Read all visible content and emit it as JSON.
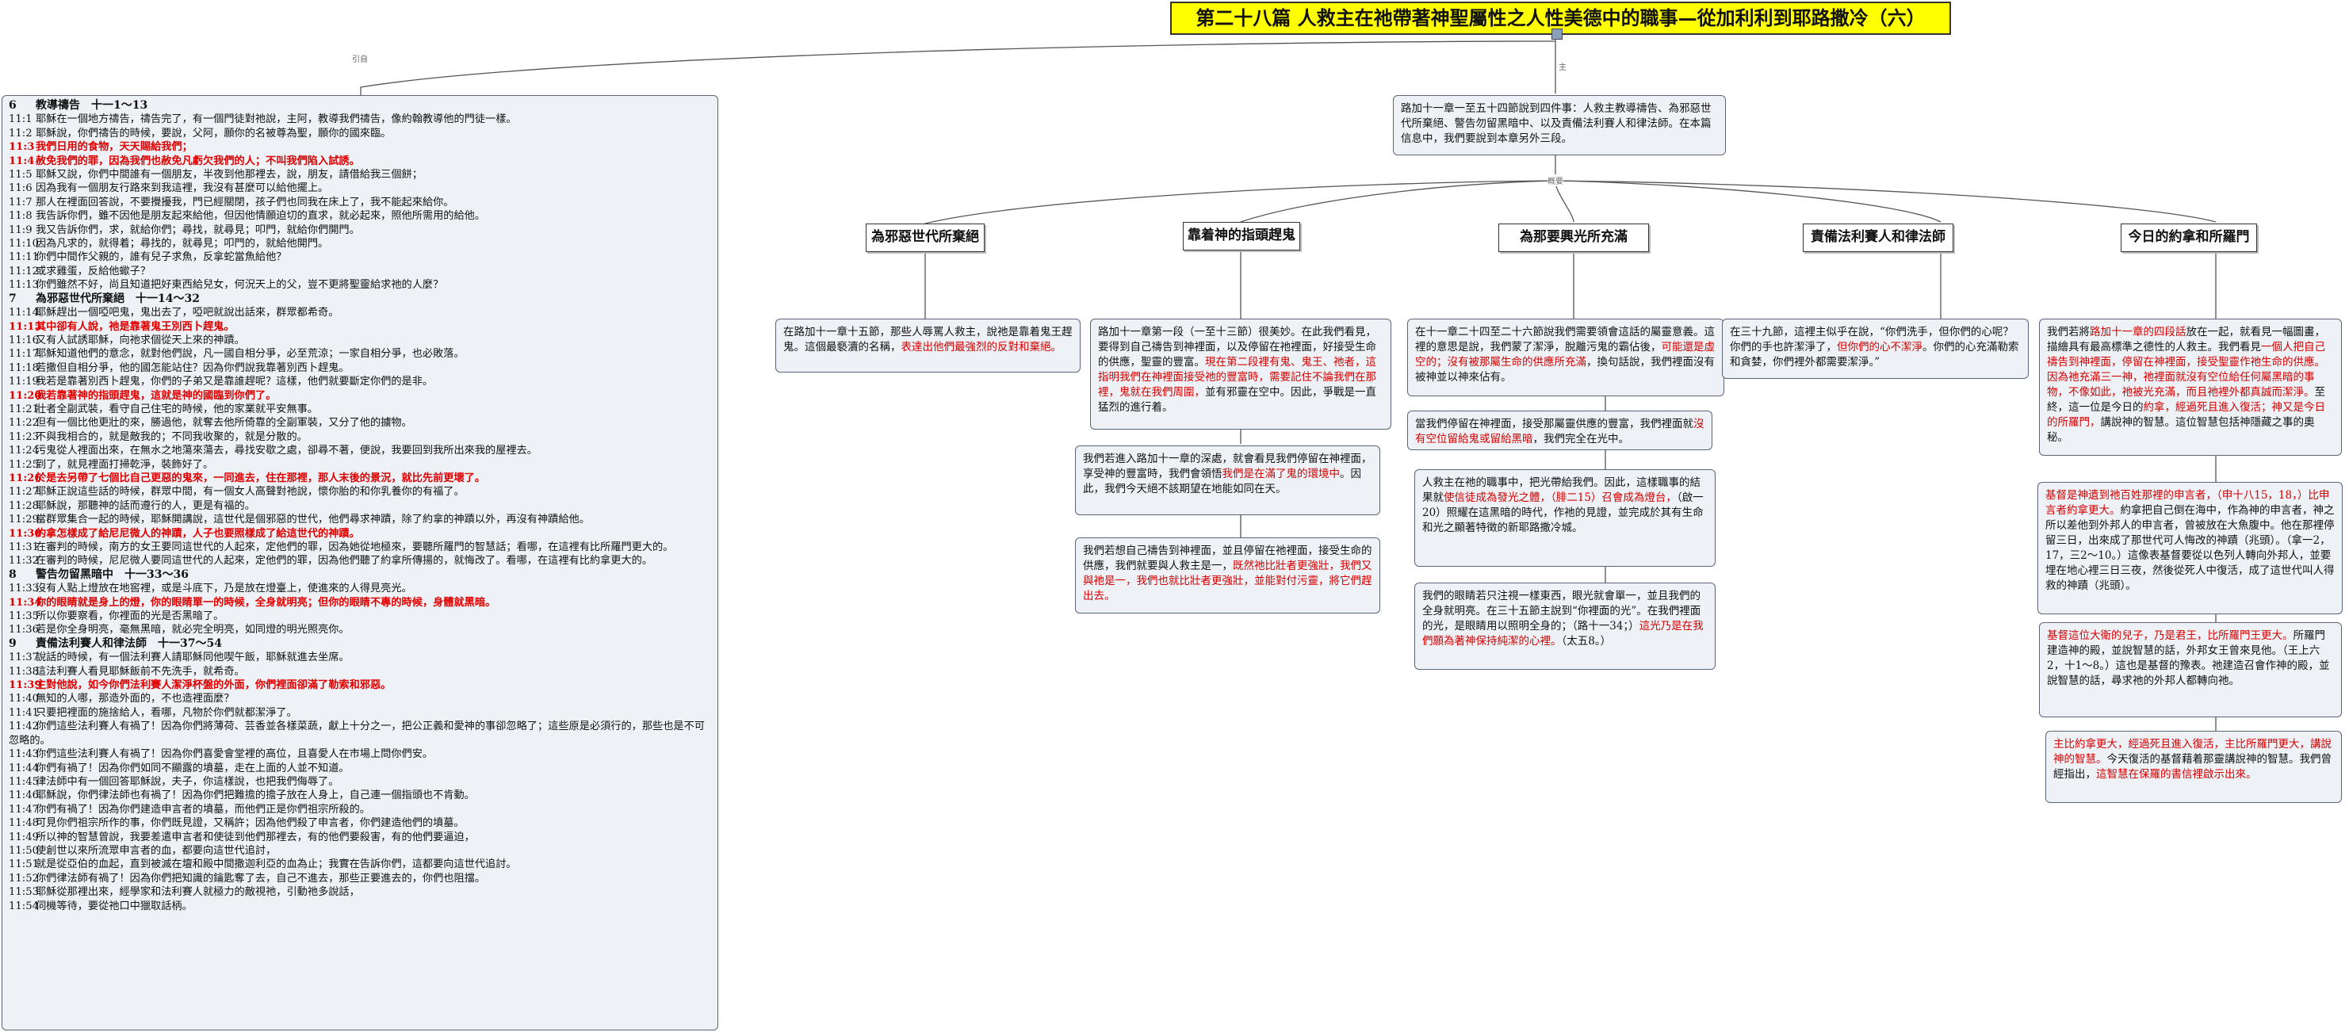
{
  "title": "第二十八篇 人救主在祂帶著神聖屬性之人性美德中的職事—從加利利到耶路撒冷（六）",
  "link_labels": {
    "quote": "引自",
    "topic": "主",
    "outline": "概要"
  },
  "outline": "路加十一章一至五十四節說到四件事：人救主教導禱告、為邪惡世代所棄絕、警告勿留黑暗中、以及責備法利賽人和律法師。在本篇信息中，我們要說到本章另外三段。",
  "headings": [
    "為邪惡世代所棄絕",
    "靠着神的指頭趕鬼",
    "為那要興光所充滿",
    "責備法利賽人和律法師",
    "今日的約拿和所羅門"
  ],
  "notes": {
    "rejected": [
      {
        "t": "在路加十一章十五節，那些人辱罵人救主，說祂是靠着鬼王趕鬼。這個最褻瀆的名稱，",
        "r": false
      },
      {
        "t": "表達出他們最強烈的反對和棄絕。",
        "r": true
      }
    ],
    "finger_1": [
      {
        "t": "路加十一章第一段（一至十三節）很美妙。在此我們看見，要得到自己禱告到神裡面，以及停留在祂裡面，好接受生命的供應，聖靈的豐富。",
        "r": false
      },
      {
        "t": "現在第二段裡有鬼、鬼王、祂者，這指明我們在神裡面接受祂的豐富時，需要記住不論我們在那裡，鬼就在我們周圍，",
        "r": true
      },
      {
        "t": "並有邪靈在空中。因此，爭戰是一直猛烈的進行着。",
        "r": false
      }
    ],
    "finger_2": [
      {
        "t": "我們若進入路加十一章的深處，就會看見我們停留在神裡面，享受神的豐富時，我們會領悟",
        "r": false
      },
      {
        "t": "我們是在滿了鬼的環境中",
        "r": true
      },
      {
        "t": "。因此，我們今天絕不該期望在地能如同在天。",
        "r": false
      }
    ],
    "finger_3": [
      {
        "t": "我們若想自己禱告到神裡面，並且停留在祂裡面，接受生命的供應，我們就要與人救主是一，",
        "r": false
      },
      {
        "t": "既然祂比壯者更強壯，我們又與祂是一，我們也就比壯者更強壯，並能對付污靈，將它們趕出去。",
        "r": true
      }
    ],
    "filled_1": [
      {
        "t": "在十一章二十四至二十六節說我們需要領會這話的屬靈意義。這裡的意思是說，我們蒙了潔淨，脫離污鬼的霸佔後，",
        "r": false
      },
      {
        "t": "可能還是虛空的；沒有被那屬生命的供應所充滿",
        "r": true
      },
      {
        "t": "，換句話說，我們裡面沒有被神並以神來佔有。",
        "r": false
      }
    ],
    "filled_2": [
      {
        "t": "當我們停留在神裡面，接受那屬靈供應的豐富，我們裡面就",
        "r": false
      },
      {
        "t": "沒有空位留給鬼或留給黑暗",
        "r": true
      },
      {
        "t": "，我們完全在光中。",
        "r": false
      }
    ],
    "filled_3": [
      {
        "t": "人救主在祂的職事中，把光帶給我們。因此，這樣職事的結果就",
        "r": false
      },
      {
        "t": "使信徒成為發光之體，（腓二15）召會成為燈台，",
        "r": true
      },
      {
        "t": "（啟一20）照耀在這黑暗的時代，作祂的見證，並完成於其有生命和光之顯著特徵的新耶路撒冷城。",
        "r": false
      }
    ],
    "filled_4": [
      {
        "t": "我們的眼睛若只注視一樣東西，眼光就會單一，並且我們的全身就明亮。在三十五節主說到“你裡面的光”。在我們裡面的光，是眼睛用以照明全身的；（路十一34；）",
        "r": false
      },
      {
        "t": "這光乃是在我們願為著神保持純潔的心裡。",
        "r": true
      },
      {
        "t": "（太五8。）",
        "r": false
      }
    ],
    "pharisees": [
      {
        "t": "在三十九節，這裡主似乎在說，“你們洗手，但你們的心呢？你們的手也許潔淨了，",
        "r": false
      },
      {
        "t": "但你們的心不潔淨",
        "r": true
      },
      {
        "t": "。你們的心充滿勒索和貪婪，你們裡外都需要潔淨。”",
        "r": false
      }
    ],
    "jonah_1": [
      {
        "t": "我們若將",
        "r": false
      },
      {
        "t": "路加十一章的四段話",
        "r": true
      },
      {
        "t": "放在一起，就看見一幅圖畫，描繪具有最高標準之德性的人救主。我們看見",
        "r": false
      },
      {
        "t": "一個人把自己禱告到神裡面，停留在神裡面，接受聖靈作祂生命的供應。因為祂充滿三一神，祂裡面就沒有空位給任何屬黑暗的事物，不像如此，祂被光充滿，而且祂裡外都真誠而潔淨。",
        "r": true
      },
      {
        "t": "至終，這一位是今日的",
        "r": false
      },
      {
        "t": "約拿，經過死且進入復活；神又是今日的所羅門，",
        "r": true
      },
      {
        "t": "講說神的智慧。這位智慧包括神隱藏之事的奧秘。",
        "r": false
      }
    ],
    "jonah_2": [
      {
        "t": "基督是神遺到祂百姓那裡的申言者，（申十八15，18，）比申言者約拿更大。",
        "r": true
      },
      {
        "t": "約拿把自己倒在海中，作為神的申言者，神之所以差他到外邦人的申言者，曾被放在大魚腹中。他在那裡停留三日，出來成了那世代可人悔改的神蹟（兆頭）。（拿一2，17，三2～10。）這像表基督要從以色列人轉向外邦人，並要埋在地心裡三日三夜，然後從死人中復活，成了這世代叫人得救的神蹟（兆頭）。",
        "r": false
      }
    ],
    "jonah_3": [
      {
        "t": "基督這位大衛的兒子，乃是君王，比所羅門王更大。",
        "r": true
      },
      {
        "t": "所羅門建造神的殿，並說智慧的話，外邦女王曾來見他。（王上六2，十1～8。）這也是基督的豫表。祂建造召會作神的殿，並說智慧的話，尋求祂的外邦人都轉向祂。",
        "r": false
      }
    ],
    "jonah_4": [
      {
        "t": "主比約拿更大，經過死且進入復活，主比所羅門更大，講說神的智慧。",
        "r": true
      },
      {
        "t": "今天復活的基督藉着那靈講說神的智慧。我們曾經指出，",
        "r": false
      },
      {
        "t": "這智慧在保羅的書信裡啟示出來。",
        "r": true
      }
    ]
  },
  "verses": [
    {
      "n": "6",
      "t": "教導禱告　十一1～13",
      "sec": true
    },
    {
      "n": "11:1",
      "t": "耶穌在一個地方禱告，禱告完了，有一個門徒對祂說，主阿，教導我們禱告，像約翰教導他的門徒一樣。"
    },
    {
      "n": "11:2",
      "t": "耶穌說，你們禱告的時候，要說，父阿，願你的名被尊為聖，願你的國來臨。"
    },
    {
      "n": "11:3",
      "t": "我們日用的食物，天天賜給我們；",
      "hl": true
    },
    {
      "n": "11:4",
      "t": "赦免我們的罪，因為我們也赦免凡虧欠我們的人；不叫我們陷入試誘。",
      "hl": true
    },
    {
      "n": "11:5",
      "t": "耶穌又說，你們中間誰有一個朋友，半夜到他那裡去，說，朋友，請借給我三個餅；"
    },
    {
      "n": "11:6",
      "t": "因為我有一個朋友行路來到我這裡，我沒有甚麼可以給他擺上。"
    },
    {
      "n": "11:7",
      "t": "那人在裡面回答說，不要攪擾我，門已經關閉，孩子們也同我在床上了，我不能起來給你。"
    },
    {
      "n": "11:8",
      "t": "我告訴你們，雖不因他是朋友起來給他，但因他情願迫切的直求，就必起來，照他所需用的給他。"
    },
    {
      "n": "11:9",
      "t": "我又告訴你們，求，就給你們；尋找，就尋見；叩門，就給你們開門。"
    },
    {
      "n": "11:10",
      "t": "因為凡求的，就得着；尋找的，就尋見；叩門的，就給他開門。"
    },
    {
      "n": "11:11",
      "t": "你們中間作父親的，誰有兒子求魚，反拿蛇當魚給他？"
    },
    {
      "n": "11:12",
      "t": "或求雞蛋，反給他蠍子？"
    },
    {
      "n": "11:13",
      "t": "你們雖然不好，尚且知道把好東西給兒女，何況天上的父，豈不更將聖靈給求祂的人麼？"
    },
    {
      "n": "7",
      "t": "為邪惡世代所棄絕　十一14～32",
      "sec": true
    },
    {
      "n": "11:14",
      "t": "耶穌趕出一個啞吧鬼，鬼出去了，啞吧就說出話來，群眾都希奇。"
    },
    {
      "n": "11:15",
      "t": "其中卻有人說，祂是靠著鬼王別西卜趕鬼。",
      "hl": true
    },
    {
      "n": "11:16",
      "t": "又有人試誘耶穌，向祂求個從天上來的神蹟。"
    },
    {
      "n": "11:17",
      "t": "耶穌知道他們的意念，就對他們說，凡一國自相分爭，必至荒涼；一家自相分爭，也必敗落。"
    },
    {
      "n": "11:18",
      "t": "若撒但自相分爭，他的國怎能站住？因為你們說我靠著別西卜趕鬼。"
    },
    {
      "n": "11:19",
      "t": "我若是靠著別西卜趕鬼，你們的子弟又是靠誰趕呢？這樣，他們就要斷定你們的是非。"
    },
    {
      "n": "11:20",
      "t": "我若靠著神的指頭趕鬼，這就是神的國臨到你們了。",
      "hl": true
    },
    {
      "n": "11:21",
      "t": "壯者全副武裝，看守自己住宅的時候，他的家業就平安無事。"
    },
    {
      "n": "11:22",
      "t": "但有一個比他更壯的來，勝過他，就奪去他所倚靠的全副軍裝，又分了他的擄物。"
    },
    {
      "n": "11:23",
      "t": "不與我相合的，就是敵我的；不同我收聚的，就是分散的。"
    },
    {
      "n": "11:24",
      "t": "污鬼從人裡面出來，在無水之地蕩來蕩去，尋找安歇之處，卻尋不著，便說，我要回到我所出來我的屋裡去。"
    },
    {
      "n": "11:25",
      "t": "到了，就見裡面打掃乾淨，裝飾好了。"
    },
    {
      "n": "11:26",
      "t": "於是去另帶了七個比自己更惡的鬼來，一同進去，住在那裡，那人末後的景況，就比先前更壞了。",
      "hl": true
    },
    {
      "n": "11:27",
      "t": "耶穌正說這些話的時候，群眾中間，有一個女人高聲對祂說，懷你胎的和你乳養你的有福了。"
    },
    {
      "n": "11:28",
      "t": "耶穌說，那聽神的話而遵行的人，更是有福的。"
    },
    {
      "n": "11:29",
      "t": "當群眾集合一起的時候，耶穌開講說，這世代是個邪惡的世代，他們尋求神蹟，除了約拿的神蹟以外，再沒有神蹟給他。"
    },
    {
      "n": "11:30",
      "t": "約拿怎樣成了給尼尼微人的神蹟，人子也要照樣成了給這世代的神蹟。",
      "hl": true
    },
    {
      "n": "11:31",
      "t": "在審判的時候，南方的女王要同這世代的人起來，定他們的罪，因為她從地極來，要聽所羅門的智慧話；看哪，在這裡有比所羅門更大的。",
      "wrap": true
    },
    {
      "n": "11:32",
      "t": "在審判的時候，尼尼微人要同這世代的人起來，定他們的罪，因為他們聽了約拿所傳揚的，就悔改了。看哪，在這裡有比約拿更大的。",
      "wrap": true
    },
    {
      "n": "8",
      "t": "警告勿留黑暗中　十一33～36",
      "sec": true
    },
    {
      "n": "11:33",
      "t": "沒有人點上燈放在地窖裡，或是斗底下，乃是放在燈臺上，使進來的人得見亮光。"
    },
    {
      "n": "11:34",
      "t": "你的眼睛就是身上的燈，你的眼睛單一的時候，全身就明亮；但你的眼睛不專的時候，身體就黑暗。",
      "hl": true
    },
    {
      "n": "11:35",
      "t": "所以你要察看，你裡面的光是否黑暗了。"
    },
    {
      "n": "11:36",
      "t": "若是你全身明亮，毫無黑暗，就必完全明亮，如同燈的明光照亮你。"
    },
    {
      "n": "9",
      "t": "責備法利賽人和律法師　十一37～54",
      "sec": true
    },
    {
      "n": "11:37",
      "t": "說話的時候，有一個法利賽人請耶穌同他喫午飯，耶穌就進去坐席。"
    },
    {
      "n": "11:38",
      "t": "這法利賽人看見耶穌飯前不先洗手，就希奇。"
    },
    {
      "n": "11:39",
      "t": "主對他說，如今你們法利賽人潔淨杯盤的外面，你們裡面卻滿了勒索和邪惡。",
      "hl": true
    },
    {
      "n": "11:40",
      "t": "無知的人哪，那造外面的，不也造裡面麼？"
    },
    {
      "n": "11:41",
      "t": "只要把裡面的施捨給人，看哪，凡物於你們就都潔淨了。"
    },
    {
      "n": "11:42",
      "t": "你們這些法利賽人有禍了！因為你們將薄荷、芸香並各樣菜蔬，獻上十分之一，把公正義和愛神的事卻忽略了；這些原是必須行的，那些也是不可忽略的。",
      "wrap": true
    },
    {
      "n": "11:43",
      "t": "你們這些法利賽人有禍了！因為你們喜愛會堂裡的高位，且喜愛人在市場上問你們安。"
    },
    {
      "n": "11:44",
      "t": "你們有禍了！因為你們如同不顯露的墳墓，走在上面的人並不知道。"
    },
    {
      "n": "11:45",
      "t": "律法師中有一個回答耶穌說，夫子，你這樣說，也把我們侮辱了。"
    },
    {
      "n": "11:46",
      "t": "耶穌說，你們律法師也有禍了！因為你們把難擔的擔子放在人身上，自己連一個指頭也不肯動。"
    },
    {
      "n": "11:47",
      "t": "你們有禍了！因為你們建造申言者的墳墓，而他們正是你們祖宗所殺的。"
    },
    {
      "n": "11:48",
      "t": "可見你們祖宗所作的事，你們既見證，又稱許；因為他們殺了申言者，你們建造他們的墳墓。"
    },
    {
      "n": "11:49",
      "t": "所以神的智慧曾說，我要差遣申言者和使徒到他們那裡去，有的他們要殺害，有的他們要逼迫，"
    },
    {
      "n": "11:50",
      "t": "使創世以來所流眾申言者的血，都要向這世代追討，"
    },
    {
      "n": "11:51",
      "t": "就是從亞伯的血起，直到被滅在壇和殿中間撒迦利亞的血為止；我實在告訴你們，這都要向這世代追討。"
    },
    {
      "n": "11:52",
      "t": "你們律法師有禍了！因為你們把知識的鑰匙奪了去，自己不進去，那些正要進去的，你們也阻擋。"
    },
    {
      "n": "11:53",
      "t": "耶穌從那裡出來，經學家和法利賽人就極力的敵視祂，引動祂多說話，"
    },
    {
      "n": "11:54",
      "t": "伺機等待，要從祂口中獵取話柄。"
    }
  ]
}
